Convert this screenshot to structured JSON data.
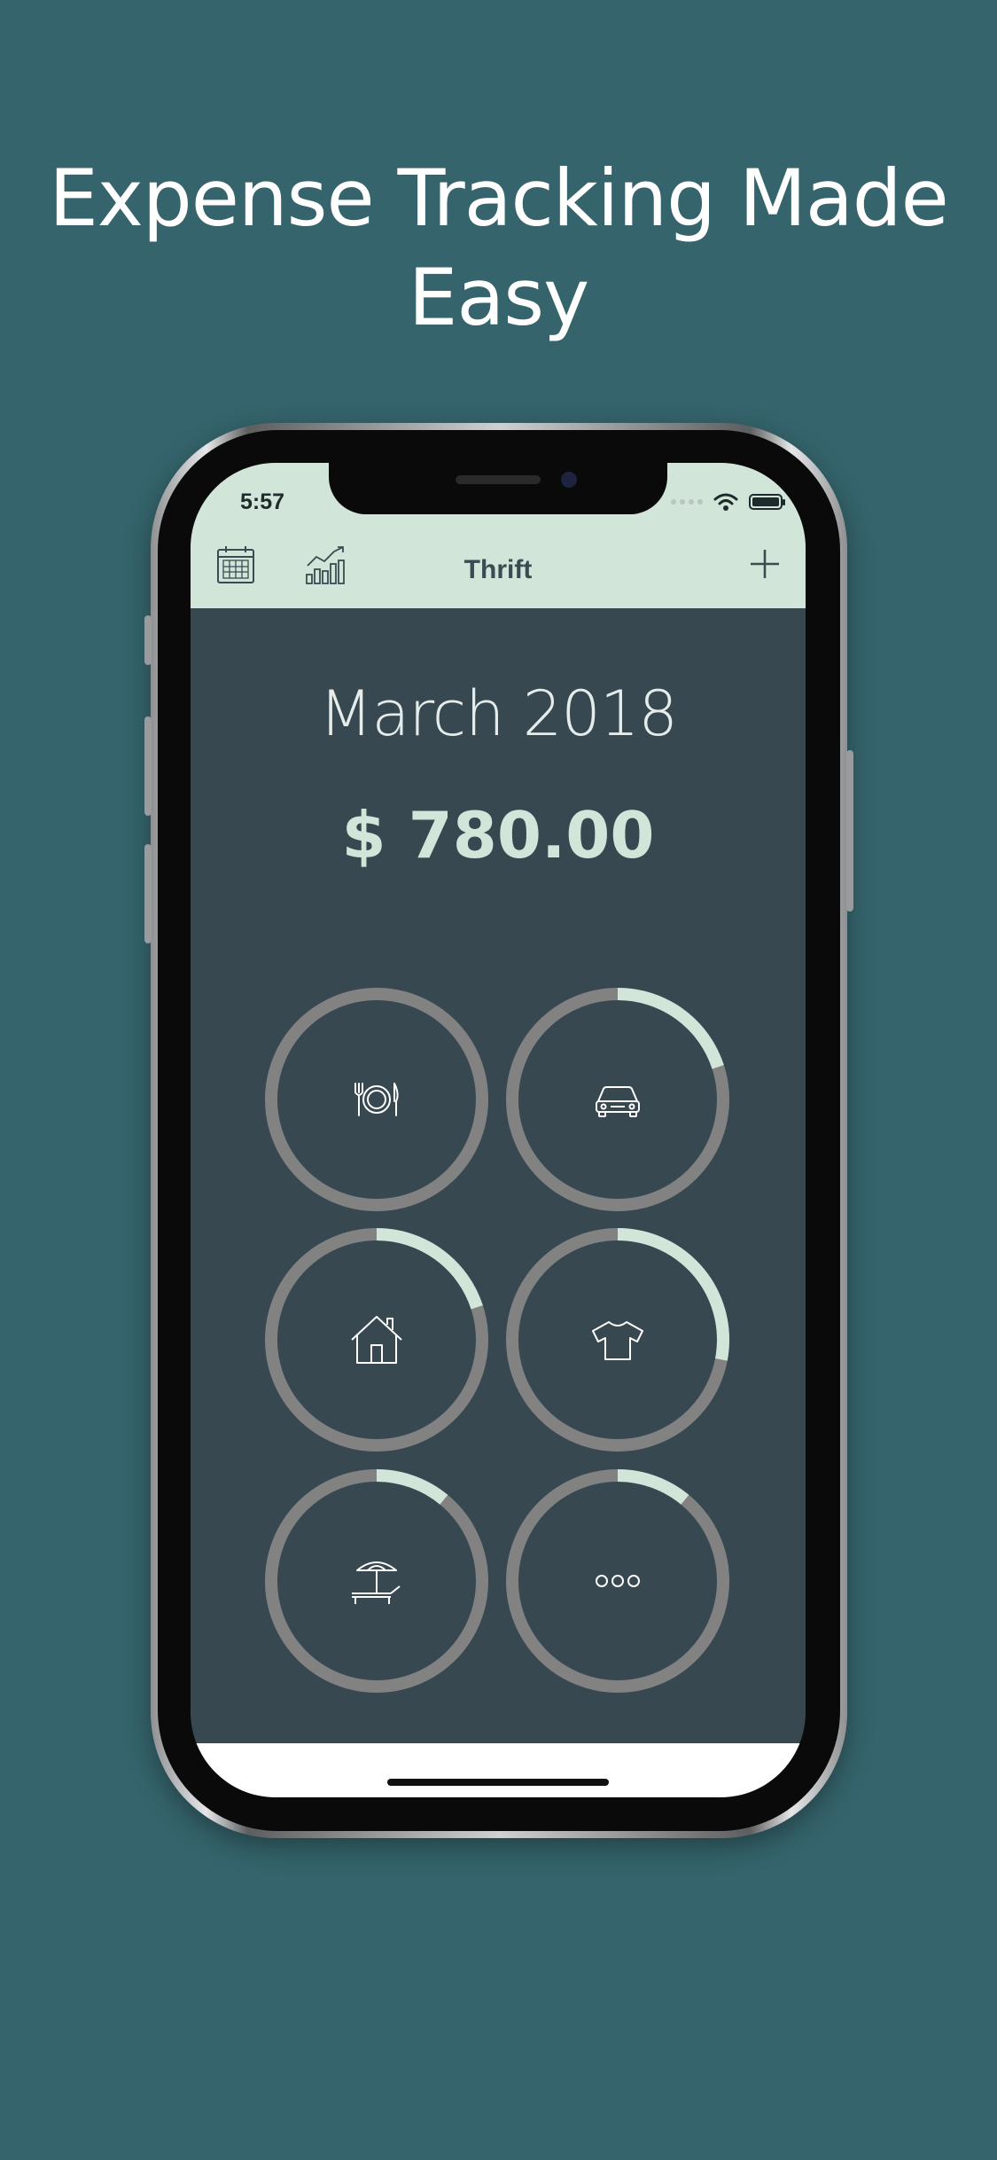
{
  "headline": {
    "line1": "Expense Tracking Made",
    "line2": "Easy"
  },
  "status_bar": {
    "time": "5:57"
  },
  "nav": {
    "title": "Thrift",
    "left_icons": [
      "calendar-icon",
      "chart-icon"
    ],
    "right_icon": "plus-icon"
  },
  "summary": {
    "month": "March 2018",
    "total": "$ 780.00"
  },
  "categories": [
    {
      "name": "food",
      "icon": "plate-cutlery-icon",
      "progress": 0.0
    },
    {
      "name": "transport",
      "icon": "car-icon",
      "progress": 0.2
    },
    {
      "name": "housing",
      "icon": "house-icon",
      "progress": 0.2
    },
    {
      "name": "clothing",
      "icon": "tshirt-icon",
      "progress": 0.28
    },
    {
      "name": "leisure",
      "icon": "beach-umbrella-icon",
      "progress": 0.11
    },
    {
      "name": "other",
      "icon": "more-icon",
      "progress": 0.11
    }
  ],
  "colors": {
    "background": "#35646c",
    "screen": "#384850",
    "accent": "#d1e5d8",
    "ring_track": "#828282",
    "nav_text": "#3b4b52"
  }
}
